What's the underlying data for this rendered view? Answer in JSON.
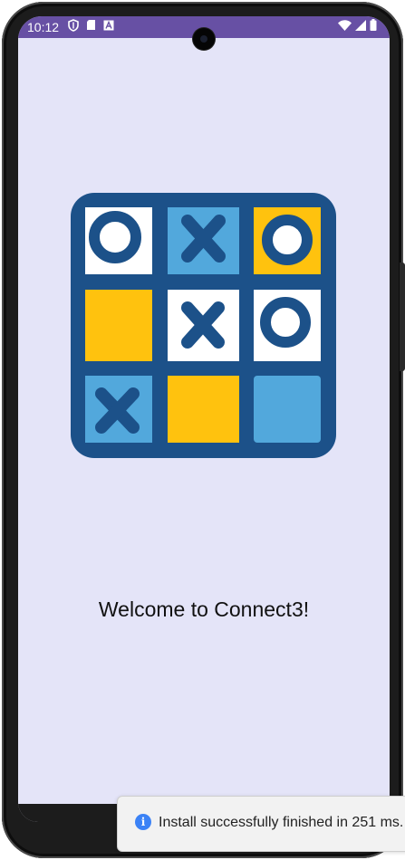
{
  "status_bar": {
    "time": "10:12",
    "left_icons": [
      "shield-icon",
      "sim-card-icon",
      "keyboard-a-icon"
    ],
    "right_icons": [
      "wifi-icon",
      "signal-icon",
      "battery-icon"
    ],
    "color": "#6750a4"
  },
  "app": {
    "logo": {
      "name": "Connect3 tic-tac-toe logo",
      "board": [
        [
          "O",
          "X",
          "O"
        ],
        [
          "",
          "X",
          "O"
        ],
        [
          "X",
          "",
          ""
        ]
      ],
      "colors": {
        "frame": "#1c5189",
        "white": "#ffffff",
        "light_blue": "#52a8dc",
        "yellow": "#ffc20e"
      }
    },
    "welcome_text": "Welcome to Connect3!",
    "background": "#e4e4f8"
  },
  "toast": {
    "icon": "info-icon",
    "message": "Install successfully finished in 251 ms."
  }
}
